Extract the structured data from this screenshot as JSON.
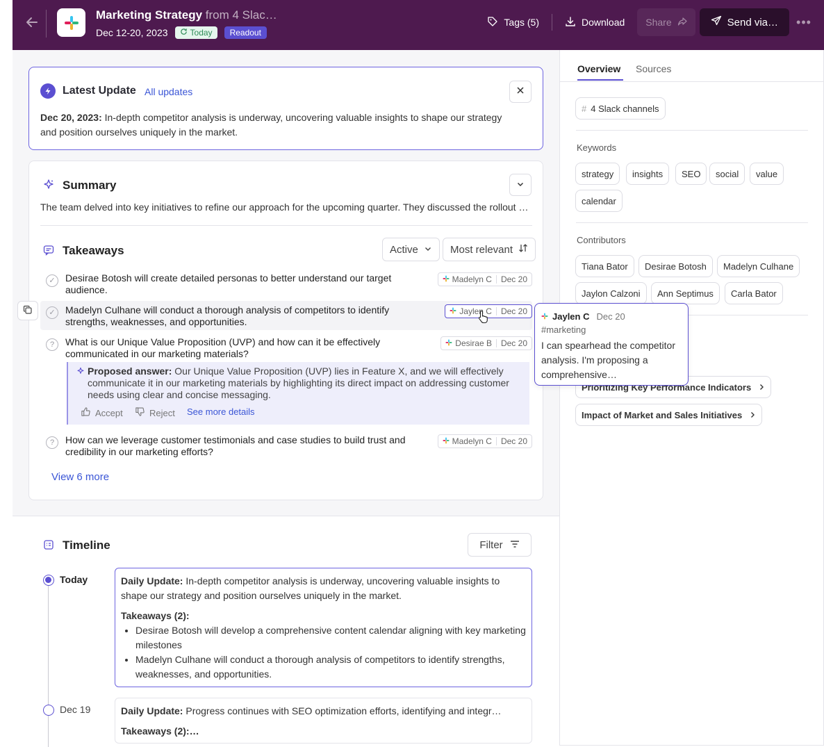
{
  "header": {
    "title": "Marketing Strategy",
    "title_suffix": "from 4 Slac…",
    "date_range": "Dec 12-20, 2023",
    "today_badge": "Today",
    "readout_badge": "Readout",
    "tags_label": "Tags (5)",
    "download_label": "Download",
    "share_label": "Share",
    "send_label": "Send via…",
    "more_label": "•••"
  },
  "latest_update": {
    "title": "Latest Update",
    "all_updates_link": "All updates",
    "date": "Dec 20, 2023:",
    "text": " In-depth competitor analysis is underway, uncovering valuable insights to shape our strategy and position ourselves uniquely in the market."
  },
  "summary": {
    "title": "Summary",
    "text": "The team delved into key initiatives to refine our approach for the upcoming quarter. They discussed the rollout of new campaigns and the teams responsible."
  },
  "takeaways": {
    "title": "Takeaways",
    "status_filter": "Active",
    "sort": "Most relevant",
    "items": [
      {
        "text": "Desirae Botosh will create detailed personas to better understand our target audience.",
        "author": "Madelyn C",
        "date": "Dec 20"
      },
      {
        "text": "Madelyn Culhane will conduct a thorough analysis of competitors to identify strengths, weaknesses, and opportunities.",
        "author": "Jaylen C",
        "date": "Dec 20"
      },
      {
        "text": "What is our Unique Value Proposition (UVP) and how can it be effectively communicated in our marketing materials?",
        "author": "Desirae B",
        "date": "Dec 20"
      },
      {
        "text": "How can we leverage customer testimonials and case studies to build trust and credibility in our marketing efforts?",
        "author": "Madelyn C",
        "date": "Dec 20"
      }
    ],
    "proposed": {
      "label": "Proposed answer:",
      "text": " Our Unique Value Proposition (UVP) lies in Feature X, and we will effectively communicate it in our marketing materials by highlighting its direct impact on addressing customer needs using clear and concise messaging.",
      "accept": "Accept",
      "reject": "Reject",
      "details": "See more details"
    },
    "view_more": "View 6 more"
  },
  "timeline": {
    "title": "Timeline",
    "filter": "Filter",
    "entries": [
      {
        "label": "Today",
        "heading": "Daily Update:",
        "text": " In-depth competitor analysis is underway, uncovering valuable insights to shape our strategy and position ourselves uniquely in the market.",
        "takeaways_label": "Takeaways (2):",
        "bullets": [
          "Desirae Botosh will develop a comprehensive content calendar aligning with key marketing milestones",
          "Madelyn Culhane will conduct a thorough analysis of competitors to identify strengths, weaknesses, and opportunities."
        ]
      },
      {
        "label": "Dec 19",
        "heading": "Daily Update:",
        "text": " Progress continues with SEO optimization efforts, identifying and integr…",
        "takeaways_label": "Takeaways (2):…"
      }
    ]
  },
  "tooltip": {
    "author": "Jaylen C",
    "date": "Dec 20",
    "channel": "#marketing",
    "message": "I can spearhead the competitor analysis. I'm proposing a comprehensive…"
  },
  "right_panel": {
    "tabs": [
      "Overview",
      "Sources"
    ],
    "channels_chip": "4 Slack channels",
    "keywords_label": "Keywords",
    "keywords": [
      "strategy",
      "insights",
      "SEO",
      "social",
      "value",
      "calendar"
    ],
    "contributors_label": "Contributors",
    "contributors": [
      "Tiana Bator",
      "Desirae Botosh",
      "Madelyn Culhane",
      "Jaylon Calzoni",
      "Ann Septimus",
      "Carla Bator"
    ],
    "topics": [
      "Prioritizing Key Performance Indicators",
      "Impact of Market and Sales Initiatives"
    ]
  },
  "colors": {
    "header_bg": "#4e1a4f",
    "accent": "#5b4fd1",
    "link": "#3a55d6"
  }
}
